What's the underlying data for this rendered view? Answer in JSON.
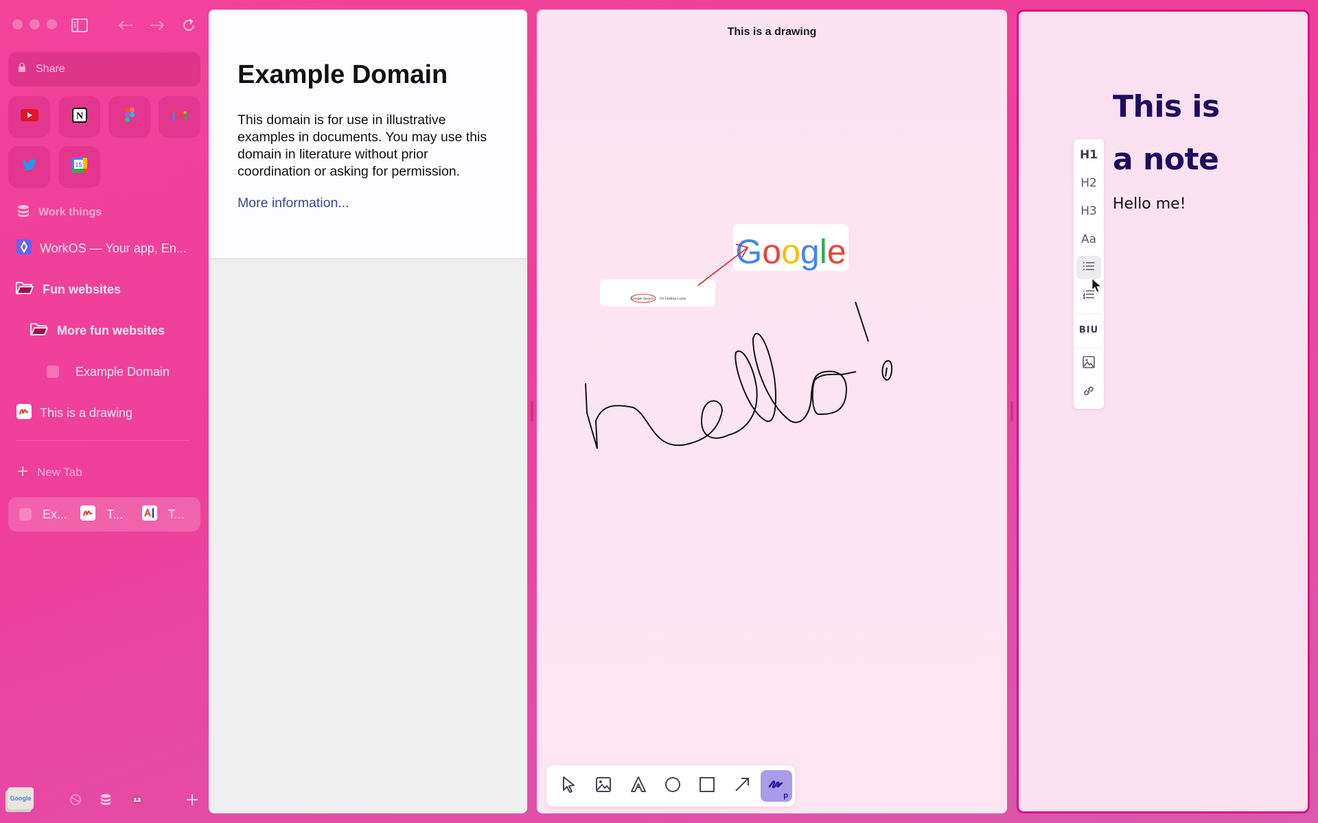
{
  "sidebar": {
    "share_label": "Share",
    "favorites": [
      {
        "name": "YouTube",
        "icon": "youtube-icon"
      },
      {
        "name": "Notion",
        "icon": "notion-icon"
      },
      {
        "name": "Figma",
        "icon": "figma-icon"
      },
      {
        "name": "Gmail",
        "icon": "gmail-icon"
      },
      {
        "name": "Twitter",
        "icon": "twitter-icon"
      },
      {
        "name": "Google Calendar",
        "icon": "calendar-icon",
        "badge": "15"
      }
    ],
    "items": [
      {
        "label": "Work things",
        "icon": "database-icon"
      },
      {
        "label": "WorkOS — Your app, En...",
        "icon": "workos-icon"
      },
      {
        "label": "Fun websites",
        "icon": "folder-open-icon"
      },
      {
        "label": "More fun websites",
        "icon": "folder-open-icon"
      },
      {
        "label": "Example Domain",
        "icon": "blank-favicon"
      },
      {
        "label": "This is a drawing",
        "icon": "drawing-favicon"
      }
    ],
    "new_tab_label": "New Tab",
    "split_tabs": [
      {
        "label": "Ex..."
      },
      {
        "label": "T..."
      },
      {
        "label": "T..."
      }
    ],
    "bottom": {
      "preview_label": "Google"
    }
  },
  "web_panel": {
    "title": "Example Domain",
    "body": "This domain is for use in illustrative examples in documents. You may use this domain in literature without prior coordination or asking for permission.",
    "link": "More information..."
  },
  "drawing_panel": {
    "title": "This is a drawing",
    "google_logo": "Google",
    "search_buttons": [
      "Google Search",
      "I'm Feeling Lucky"
    ],
    "tools": [
      {
        "name": "select"
      },
      {
        "name": "image"
      },
      {
        "name": "text"
      },
      {
        "name": "ellipse"
      },
      {
        "name": "rectangle"
      },
      {
        "name": "arrow"
      },
      {
        "name": "pen",
        "shortcut": "p",
        "active": true
      }
    ]
  },
  "note_panel": {
    "title_line1": "This is",
    "title_line2": "a note",
    "body": "Hello me!",
    "format_items": [
      "H1",
      "H2",
      "H3",
      "Aa",
      "bullet-list",
      "numbered-list",
      "BIU",
      "image",
      "link"
    ]
  },
  "colors": {
    "accent": "#ef3f9a",
    "note_border": "#dc0a82",
    "note_title": "#1e0c5e",
    "active_tool": "#a99ce8",
    "link": "#38488f"
  }
}
